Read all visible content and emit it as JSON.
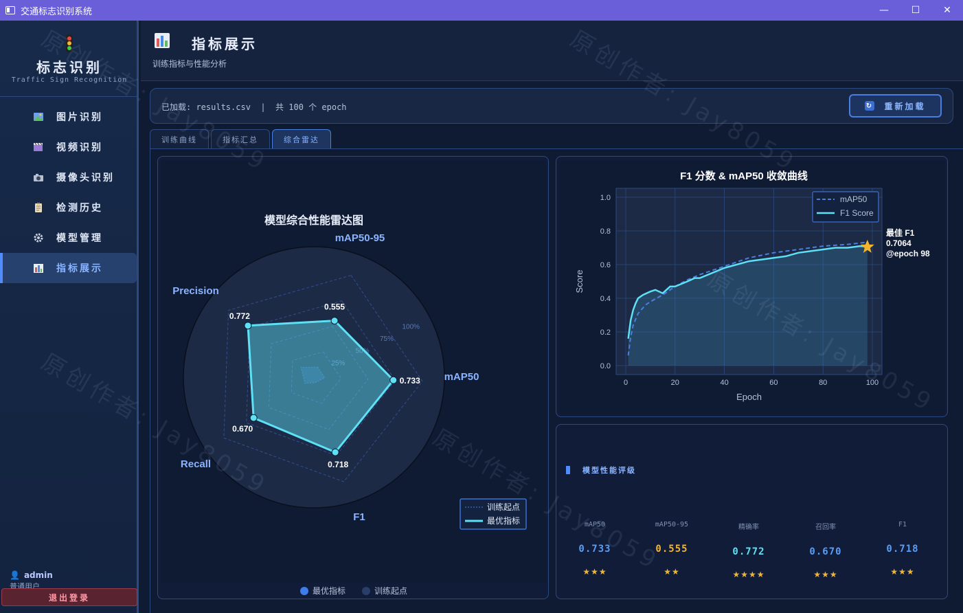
{
  "window": {
    "title": "交通标志识别系统",
    "minimize": "—",
    "maximize": "☐",
    "close": "✕"
  },
  "sidebar": {
    "logo_name": "标志识别",
    "logo_sub": "Traffic Sign Recognition",
    "items": [
      {
        "label": "图片识别",
        "icon": "image-icon"
      },
      {
        "label": "视频识别",
        "icon": "video-icon"
      },
      {
        "label": "摄像头识别",
        "icon": "camera-icon"
      },
      {
        "label": "检测历史",
        "icon": "history-icon"
      },
      {
        "label": "模型管理",
        "icon": "gear-icon"
      },
      {
        "label": "指标展示",
        "icon": "chart-icon",
        "active": true
      }
    ],
    "user": {
      "name": "admin",
      "role": "普通用户"
    },
    "logout": "退出登录"
  },
  "header": {
    "title": "指标展示",
    "subtitle": "训练指标与性能分析"
  },
  "infobar": {
    "loaded": "已加载: results.csv  |  共 100 个 epoch",
    "reload": "重新加载"
  },
  "tabs": [
    {
      "label": "训练曲线"
    },
    {
      "label": "指标汇总"
    },
    {
      "label": "综合雷达",
      "active": true
    }
  ],
  "radar": {
    "title": "模型综合性能雷达图",
    "axes": [
      "mAP50-95",
      "mAP50",
      "F1",
      "Recall",
      "Precision"
    ],
    "best_values": [
      0.555,
      0.733,
      0.718,
      0.67,
      0.772
    ],
    "start_values": [
      0.1,
      0.1,
      0.05,
      0.1,
      0.15
    ],
    "value_labels": [
      "0.555",
      "0.733",
      "0.718",
      "0.670",
      "0.772"
    ],
    "ring_labels": [
      "25%",
      "50%",
      "75%",
      "100%"
    ],
    "legend_inner": [
      "训练起点",
      "最优指标"
    ],
    "legend_bottom": [
      "最优指标",
      "训练起点"
    ],
    "colors": {
      "best": "#5ee0f5",
      "start": "#3a5fb0",
      "bottom_best": "#3d7eea",
      "bottom_start": "#2a3e6a"
    }
  },
  "chart_data": {
    "type": "line",
    "title": "F1 分数 & mAP50 收敛曲线",
    "xlabel": "Epoch",
    "ylabel": "Score",
    "xlim": [
      0,
      100
    ],
    "ylim": [
      0,
      1.0
    ],
    "xticks": [
      "0",
      "20",
      "40",
      "60",
      "80",
      "100"
    ],
    "yticks": [
      "0.0",
      "0.2",
      "0.4",
      "0.6",
      "0.8",
      "1.0"
    ],
    "legend": "top-right",
    "series": [
      {
        "name": "mAP50",
        "style": "dashed",
        "color": "#4a7fe0",
        "x": [
          1,
          2,
          3,
          5,
          8,
          10,
          15,
          20,
          25,
          30,
          40,
          50,
          60,
          70,
          80,
          90,
          98
        ],
        "y": [
          0.06,
          0.17,
          0.24,
          0.31,
          0.36,
          0.38,
          0.42,
          0.47,
          0.51,
          0.54,
          0.59,
          0.64,
          0.67,
          0.69,
          0.71,
          0.72,
          0.733
        ]
      },
      {
        "name": "F1 Score",
        "style": "solid",
        "color": "#5ee0f5",
        "x": [
          1,
          2,
          3,
          4,
          5,
          7,
          10,
          12,
          15,
          18,
          20,
          25,
          28,
          30,
          35,
          40,
          45,
          50,
          55,
          60,
          65,
          70,
          75,
          80,
          85,
          90,
          95,
          98
        ],
        "y": [
          0.16,
          0.27,
          0.33,
          0.37,
          0.4,
          0.42,
          0.44,
          0.45,
          0.43,
          0.47,
          0.47,
          0.5,
          0.52,
          0.52,
          0.55,
          0.58,
          0.6,
          0.62,
          0.63,
          0.64,
          0.65,
          0.67,
          0.68,
          0.69,
          0.7,
          0.7,
          0.71,
          0.706
        ]
      }
    ],
    "annotation": {
      "lines": [
        "最佳 F1",
        "0.7064",
        "@epoch 98"
      ],
      "x": 98,
      "y": 0.7064
    }
  },
  "score_panel": {
    "title": "模型性能评级",
    "items": [
      {
        "label": "mAP50",
        "value": "0.733",
        "stars": "★★★",
        "color": "#5b9cf5"
      },
      {
        "label": "mAP50-95",
        "value": "0.555",
        "stars": "★★",
        "color": "#f4b52e"
      },
      {
        "label": "精确率",
        "value": "0.772",
        "stars": "★★★★",
        "color": "#5ee0f5"
      },
      {
        "label": "召回率",
        "value": "0.670",
        "stars": "★★★",
        "color": "#5b9cf5"
      },
      {
        "label": "F1",
        "value": "0.718",
        "stars": "★★★",
        "color": "#5b9cf5"
      }
    ]
  },
  "watermarks": [
    "原创作者: Jay8059"
  ]
}
